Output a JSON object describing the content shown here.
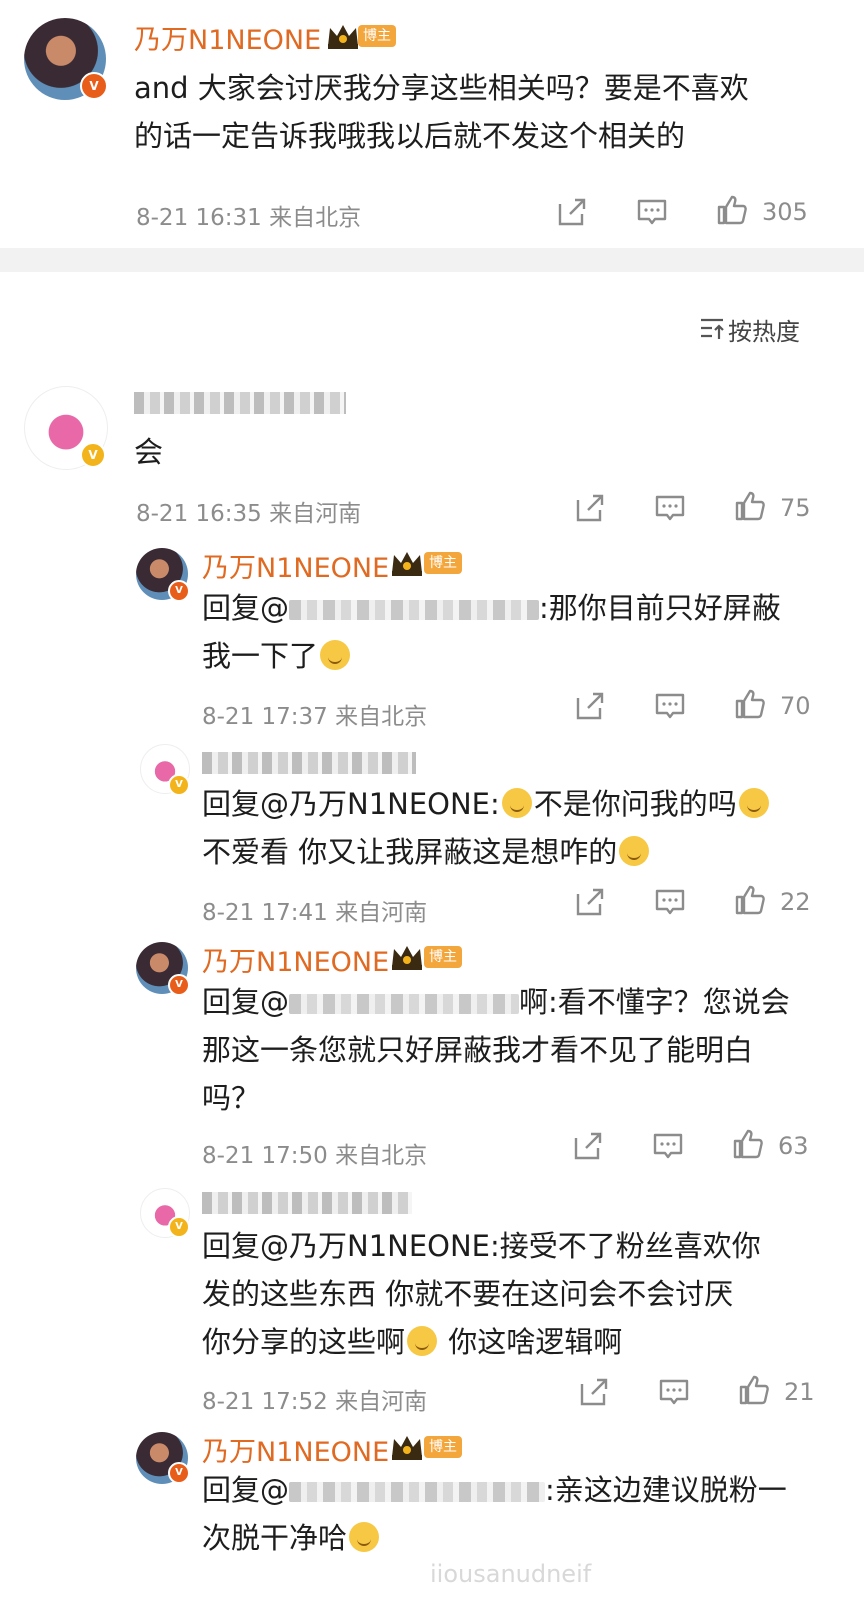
{
  "post": {
    "author": "乃万N1NEONE",
    "tag": "博主",
    "text_line1": "and 大家会讨厌我分享这些相关吗？要是不喜欢",
    "text_line2": "的话一定告诉我哦我以后就不发这个相关的",
    "meta": "8-21 16:31 来自北京",
    "likes": "305"
  },
  "sort": {
    "label": "按热度",
    "icon": "sort-icon"
  },
  "comments": [
    {
      "text": "会",
      "meta": "8-21 16:35 来自河南",
      "likes": "75"
    },
    {
      "author": "乃万N1NEONE",
      "tag": "博主",
      "prefix": "回复@",
      "text_line1_end": ":那你目前只好屏蔽",
      "text_line2": "我一下了",
      "meta": "8-21 17:37 来自北京",
      "likes": "70"
    },
    {
      "text_line1_a": "回复@乃万N1NEONE:",
      "text_line1_b": "不是你问我的吗",
      "text_line2": "不爱看 你又让我屏蔽这是想咋的",
      "meta": "8-21 17:41 来自河南",
      "likes": "22"
    },
    {
      "author": "乃万N1NEONE",
      "tag": "博主",
      "prefix": "回复@",
      "text_line1_end": "啊:看不懂字？您说会",
      "text_line2": "那这一条您就只好屏蔽我才看不见了能明白",
      "text_line3": "吗？",
      "meta": "8-21 17:50 来自北京",
      "likes": "63"
    },
    {
      "text_line1": "回复@乃万N1NEONE:接受不了粉丝喜欢你",
      "text_line2": "发的这些东西 你就不要在这问会不会讨厌",
      "text_line3_a": "你分享的这些啊",
      "text_line3_b": " 你这啥逻辑啊",
      "meta": "8-21 17:52 来自河南",
      "likes": "21"
    },
    {
      "author": "乃万N1NEONE",
      "tag": "博主",
      "prefix": "回复@",
      "text_line1_end": ":亲这边建议脱粉一",
      "text_line2": "次脱干净哈"
    }
  ],
  "watermark": "iiousanudneif",
  "colors": {
    "name": "#e06a22",
    "tag": "#f3a63b",
    "meta": "#8c8c8c"
  }
}
